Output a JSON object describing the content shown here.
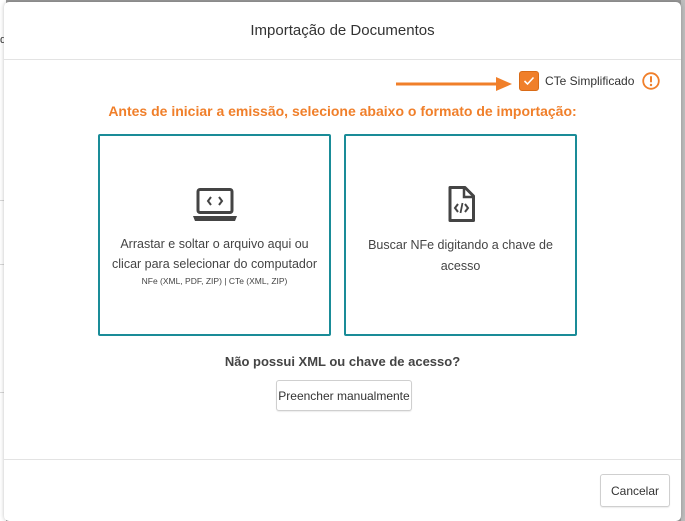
{
  "modal": {
    "title": "Importação de Documentos",
    "cte_checkbox_label": "CTe Simplificado",
    "cte_checked": true,
    "instruction": "Antes de iniciar a emissão, selecione abaixo o formato de importação:",
    "upload_option": {
      "line1": "Arrastar e soltar o arquivo aqui ou",
      "line2": "clicar para selecionar do computador",
      "formats": "NFe (XML, PDF, ZIP) | CTe (XML, ZIP)",
      "icon": "laptop-code-icon"
    },
    "key_option": {
      "line1": "Buscar NFe digitando a chave de",
      "line2": "acesso",
      "icon": "file-code-icon"
    },
    "no_xml_question": "Não possui XML ou chave de acesso?",
    "manual_button": "Preencher manualmente",
    "cancel_button": "Cancelar"
  },
  "background": {
    "fragment_text": "d"
  },
  "colors": {
    "accent_orange": "#f07f2a",
    "teal_border": "#1a8c98",
    "overlay": "#9a9a9a"
  }
}
